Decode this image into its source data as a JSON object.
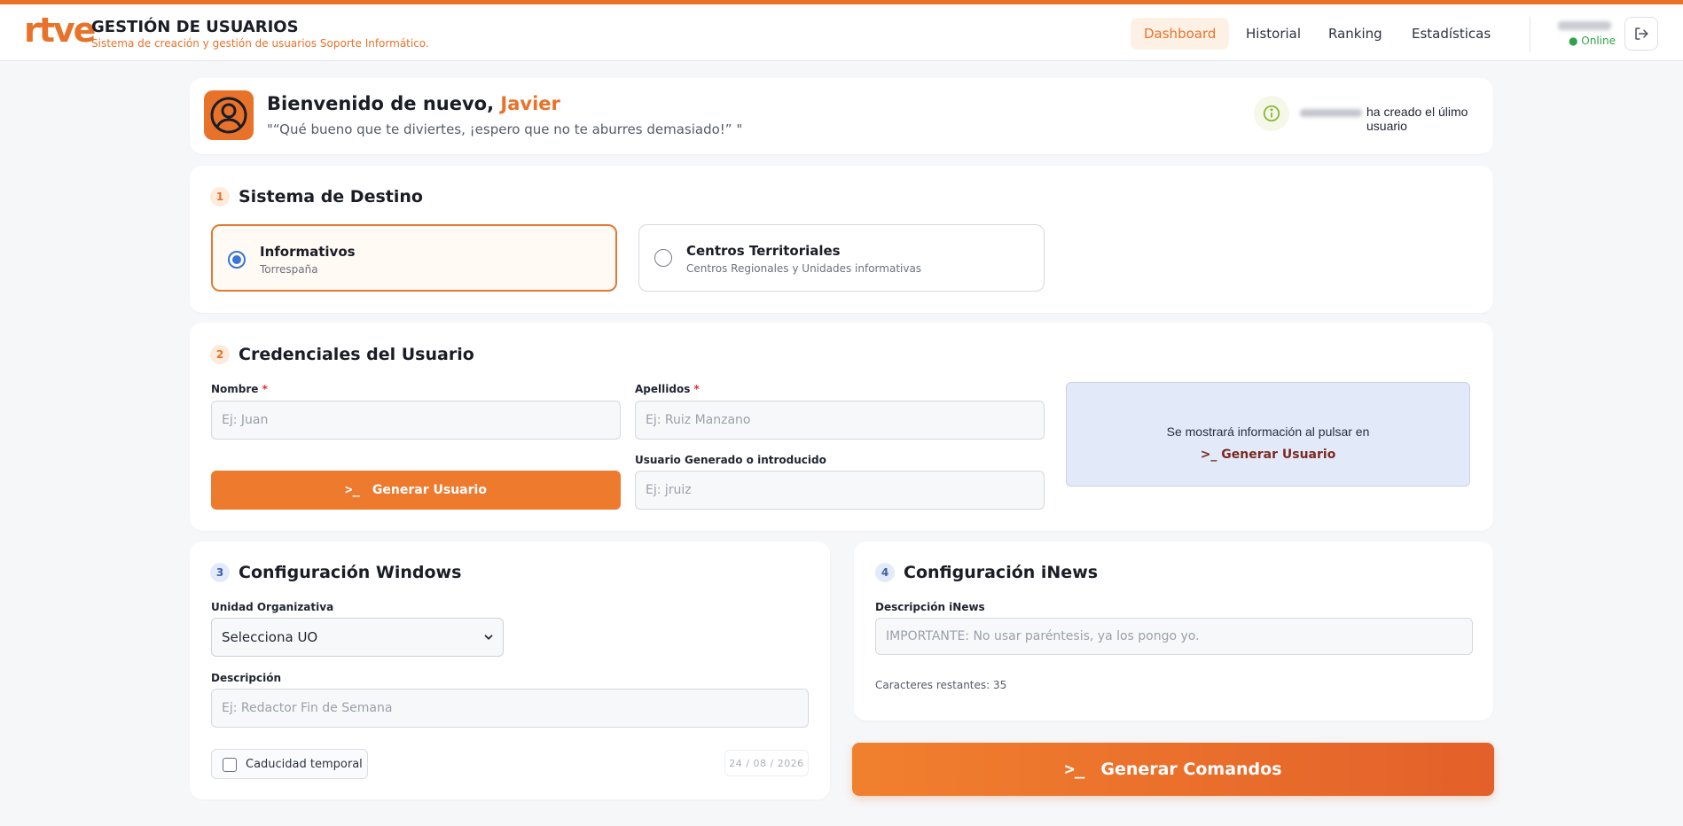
{
  "header": {
    "logo": "rtve",
    "title": "GESTIÓN DE USUARIOS",
    "subtitle": "Sistema de creación y gestión de usuarios Soporte Informático.",
    "nav": [
      {
        "label": "Dashboard",
        "active": true
      },
      {
        "label": "Historial",
        "active": false
      },
      {
        "label": "Ranking",
        "active": false
      },
      {
        "label": "Estadísticas",
        "active": false
      }
    ],
    "user_status": "● Online"
  },
  "welcome": {
    "greeting": "Bienvenido de nuevo, ",
    "name": "Javier",
    "quote": "\"“Qué bueno que te diviertes, ¡espero que no te aburres demasiado!” \"",
    "last_user_text": "ha creado el úlimo usuario"
  },
  "destino": {
    "step": "1",
    "title": "Sistema de Destino",
    "options": [
      {
        "title": "Informativos",
        "subtitle": "Torrespaña",
        "selected": true
      },
      {
        "title": "Centros Territoriales",
        "subtitle": "Centros Regionales y Unidades informativas",
        "selected": false
      }
    ]
  },
  "credenciales": {
    "step": "2",
    "title": "Credenciales del Usuario",
    "nombre_label": "Nombre",
    "nombre_placeholder": "Ej: Juan",
    "apellidos_label": "Apellidos",
    "apellidos_placeholder": "Ej: Ruiz Manzano",
    "required_mark": "*",
    "generar_button": "Generar Usuario",
    "prompt_glyph": ">_",
    "usuario_label": "Usuario Generado o introducido",
    "usuario_placeholder": "Ej: jruiz",
    "info_text": "Se mostrará información al pulsar en",
    "info_link": ">_ Generar Usuario"
  },
  "windows": {
    "step": "3",
    "title": "Configuración Windows",
    "uo_label": "Unidad Organizativa",
    "uo_selected": "Selecciona UO",
    "descripcion_label": "Descripción",
    "descripcion_placeholder": "Ej: Redactor Fin de Semana",
    "caducidad_label": "Caducidad temporal",
    "date_value": "24 / 08 / 2026"
  },
  "inews": {
    "step": "4",
    "title": "Configuración iNews",
    "descripcion_label": "Descripción iNews",
    "descripcion_placeholder": "IMPORTANTE: No usar paréntesis, ya los pongo yo.",
    "chars_left": "Caracteres restantes: 35"
  },
  "generar_comandos": {
    "label": "Generar Comandos",
    "prompt_glyph": ">_"
  },
  "colors": {
    "accent": "#e9722a",
    "online": "#2fa24a",
    "info_panel": "#e2eafa"
  }
}
